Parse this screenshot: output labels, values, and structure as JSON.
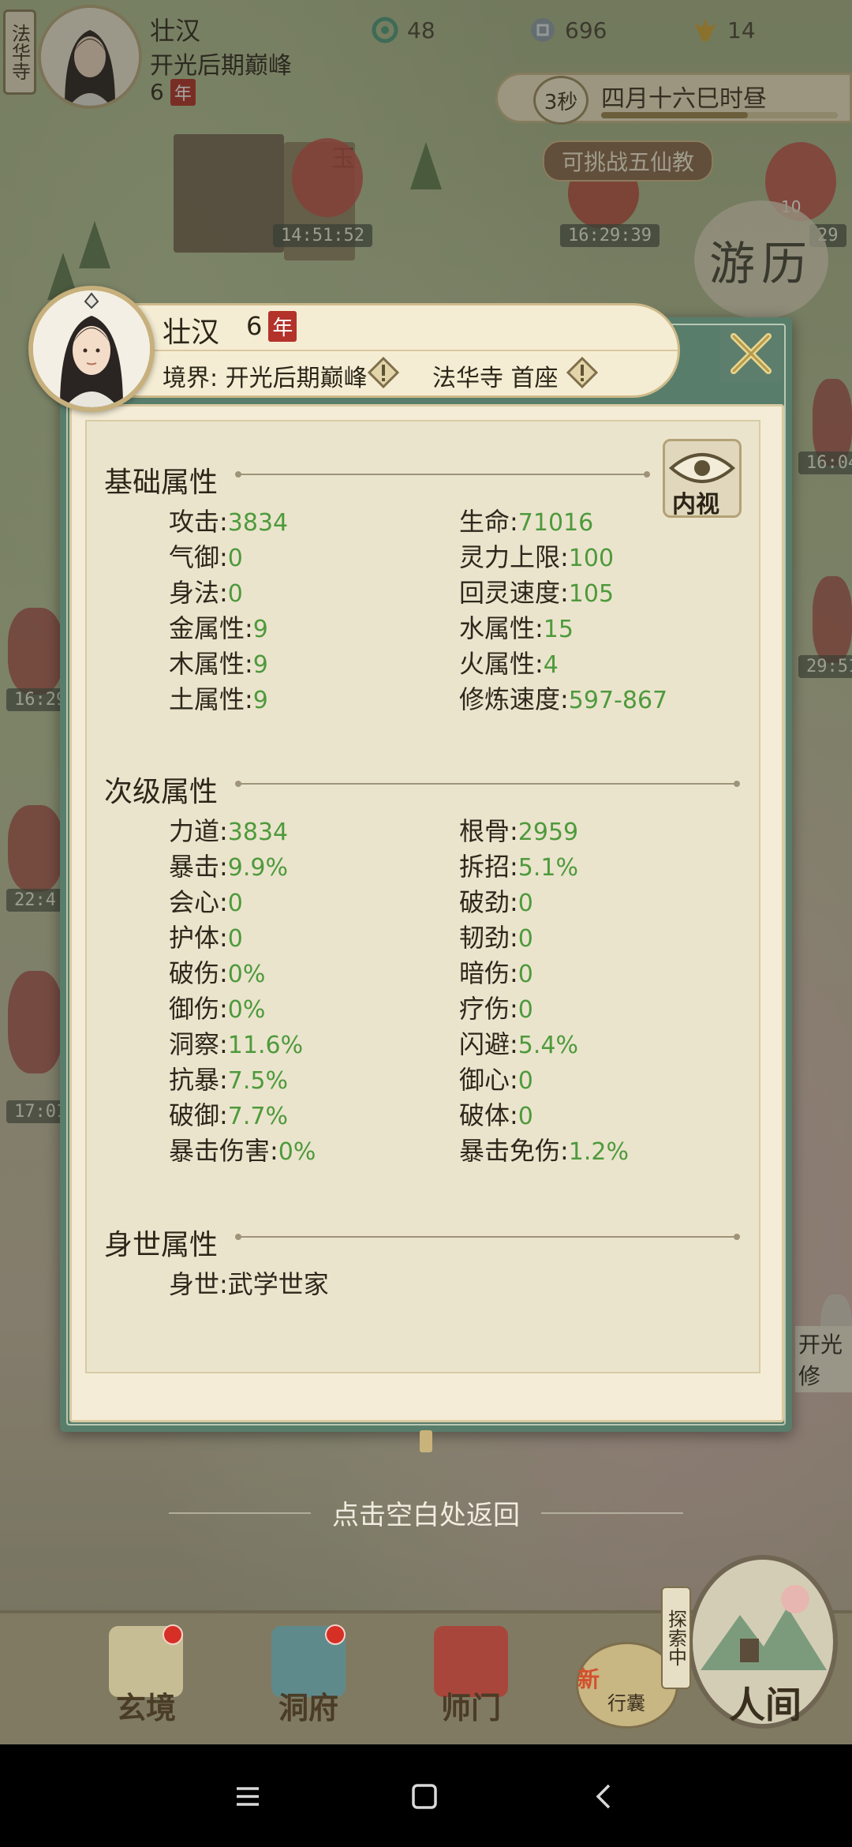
{
  "top_hud": {
    "sect_tag": "法华寺",
    "name": "壮汉",
    "realm": "开光后期巅峰",
    "age": "6",
    "year_char": "年",
    "resources": [
      {
        "icon": "spirit-stone-icon",
        "value": "48"
      },
      {
        "icon": "coin-icon",
        "value": "696"
      },
      {
        "icon": "strength-icon",
        "value": "14"
      }
    ],
    "timer_seconds": "3秒",
    "game_time": "四月十六巳时昼",
    "challenge": "可挑战五仙教",
    "youli": "游历"
  },
  "map_timers": [
    "14:51:52",
    "16:29:39",
    "29",
    "16:04",
    "29:51",
    "16:29",
    "22:4",
    "17:01"
  ],
  "map_labels": {
    "jade": "玉",
    "right_realm": "开光修",
    "badge_num": "10"
  },
  "modal": {
    "header": {
      "name": "壮汉",
      "age": "6",
      "year_char": "年",
      "realm": "境界: 开光后期巅峰",
      "sect": "法华寺 首座"
    },
    "eye_label": "内视",
    "sections": [
      {
        "title": "基础属性",
        "rows": [
          [
            {
              "label": "攻击",
              "value": "3834"
            },
            {
              "label": "生命",
              "value": "71016"
            }
          ],
          [
            {
              "label": "气御",
              "value": "0"
            },
            {
              "label": "灵力上限",
              "value": "100"
            }
          ],
          [
            {
              "label": "身法",
              "value": "0"
            },
            {
              "label": "回灵速度",
              "value": "105"
            }
          ],
          [
            {
              "label": "金属性",
              "value": "9"
            },
            {
              "label": "水属性",
              "value": "15"
            }
          ],
          [
            {
              "label": "木属性",
              "value": "9"
            },
            {
              "label": "火属性",
              "value": "4"
            }
          ],
          [
            {
              "label": "土属性",
              "value": "9"
            },
            {
              "label": "修炼速度",
              "value": "597-867"
            }
          ]
        ]
      },
      {
        "title": "次级属性",
        "rows": [
          [
            {
              "label": "力道",
              "value": "3834"
            },
            {
              "label": "根骨",
              "value": "2959"
            }
          ],
          [
            {
              "label": "暴击",
              "value": "9.9%"
            },
            {
              "label": "拆招",
              "value": "5.1%"
            }
          ],
          [
            {
              "label": "会心",
              "value": "0"
            },
            {
              "label": "破劲",
              "value": "0"
            }
          ],
          [
            {
              "label": "护体",
              "value": "0"
            },
            {
              "label": "韧劲",
              "value": "0"
            }
          ],
          [
            {
              "label": "破伤",
              "value": "0%"
            },
            {
              "label": "暗伤",
              "value": "0"
            }
          ],
          [
            {
              "label": "御伤",
              "value": "0%"
            },
            {
              "label": "疗伤",
              "value": "0"
            }
          ],
          [
            {
              "label": "洞察",
              "value": "11.6%"
            },
            {
              "label": "闪避",
              "value": "5.4%"
            }
          ],
          [
            {
              "label": "抗暴",
              "value": "7.5%"
            },
            {
              "label": "御心",
              "value": "0"
            }
          ],
          [
            {
              "label": "破御",
              "value": "7.7%"
            },
            {
              "label": "破体",
              "value": "0"
            }
          ],
          [
            {
              "label": "暴击伤害",
              "value": "0%"
            },
            {
              "label": "暴击免伤",
              "value": "1.2%"
            }
          ]
        ]
      },
      {
        "title": "身世属性",
        "rows": [
          [
            {
              "label": "身世",
              "value": "武学世家"
            }
          ]
        ]
      }
    ]
  },
  "return_hint": "点击空白处返回",
  "bottom_nav": {
    "items": [
      {
        "label": "玄境",
        "has_dot": true
      },
      {
        "label": "洞府",
        "has_dot": true
      },
      {
        "label": "师门",
        "has_dot": false
      }
    ],
    "bag_new": "新",
    "bag_label": "行囊",
    "explore_tag": "探索中",
    "renjian": "人间"
  },
  "colors": {
    "frame_green": "#587d6b",
    "paper": "#f4ecd6",
    "value_green": "#4e9a3c",
    "year_red": "#b3322a"
  }
}
